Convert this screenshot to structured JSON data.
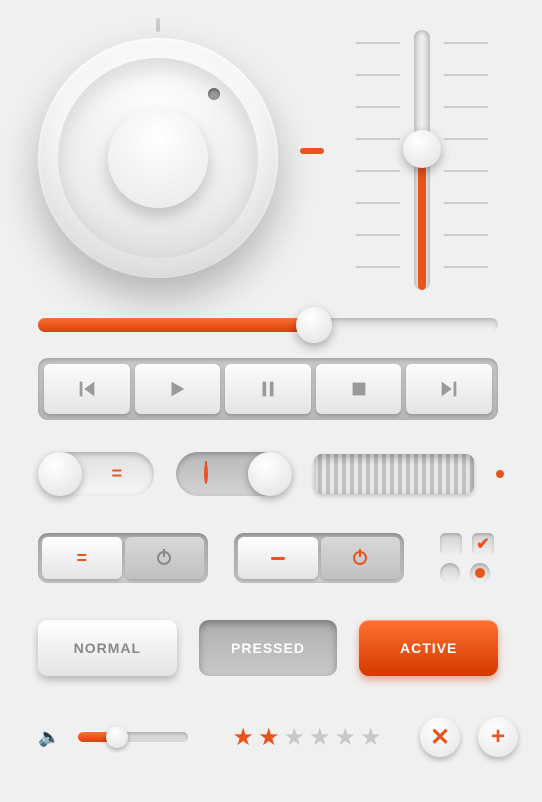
{
  "accent_color": "#e8541e",
  "knob": {
    "angle_deg": 40
  },
  "vertical_slider": {
    "value_pct": 55,
    "ticks": 8
  },
  "seek_slider": {
    "value_pct": 60
  },
  "media_buttons": [
    "prev",
    "play",
    "pause",
    "stop",
    "next"
  ],
  "toggles": {
    "switch_a": {
      "state": "on",
      "icon": "equals"
    },
    "switch_b": {
      "state": "off",
      "icon": "power"
    }
  },
  "segmented": {
    "group_a": {
      "left_icon": "equals",
      "right_icon": "power",
      "active": "left"
    },
    "group_b": {
      "left_icon": "minus",
      "right_icon": "power",
      "active": "left"
    }
  },
  "checkboxes": {
    "a": false,
    "b": true
  },
  "radios": {
    "a": false,
    "b": true
  },
  "state_buttons": {
    "normal_label": "NORMAL",
    "pressed_label": "PRESSED",
    "active_label": "ACTIVE"
  },
  "volume": {
    "value_pct": 35
  },
  "rating": {
    "value": 2,
    "max": 6
  }
}
